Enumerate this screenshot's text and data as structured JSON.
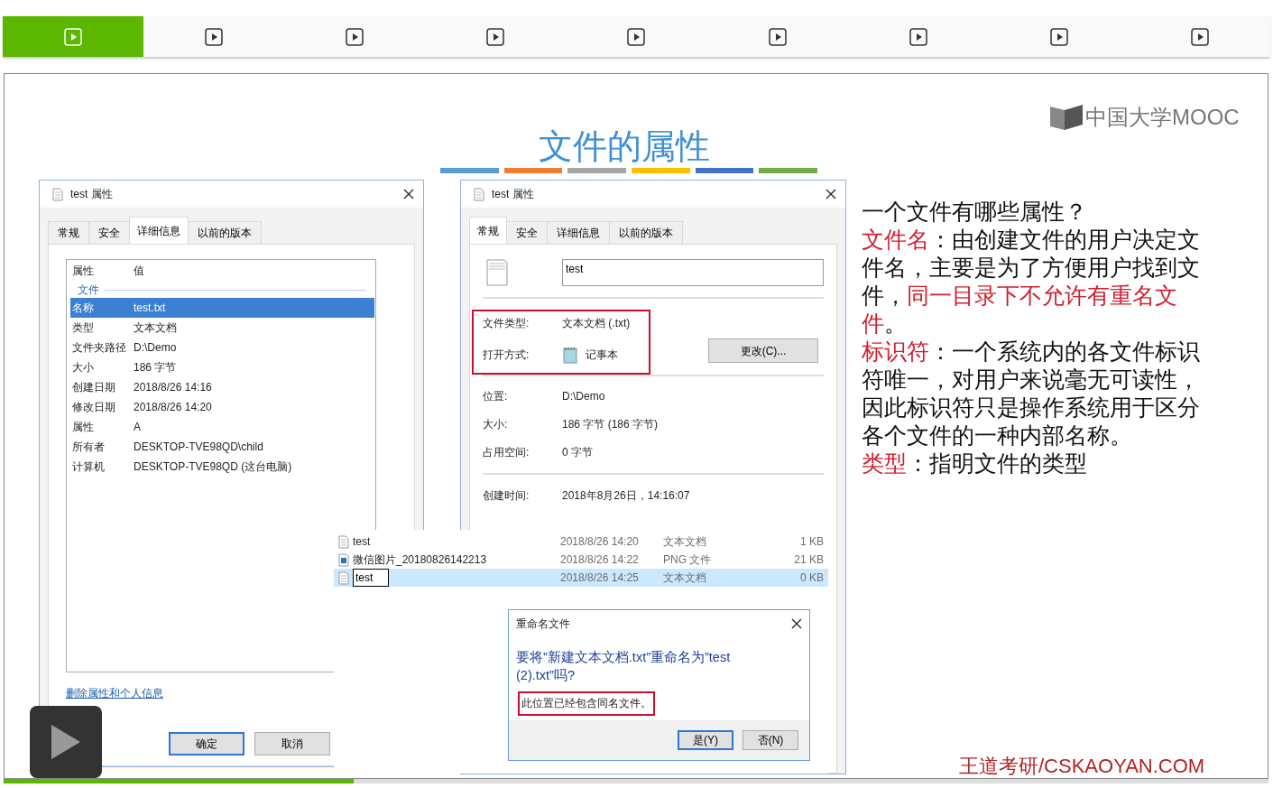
{
  "segments": [
    {
      "selected": true
    },
    {
      "selected": false
    },
    {
      "selected": false
    },
    {
      "selected": false
    },
    {
      "selected": false
    },
    {
      "selected": false
    },
    {
      "selected": false
    },
    {
      "selected": false
    },
    {
      "selected": false
    }
  ],
  "slide": {
    "title": "文件的属性",
    "logo": "中国大学MOOC",
    "details_dialog": {
      "title": "test 属性",
      "tabs": [
        {
          "label": "常规",
          "selected": false
        },
        {
          "label": "安全",
          "selected": false
        },
        {
          "label": "详细信息",
          "selected": true
        },
        {
          "label": "以前的版本",
          "selected": false
        }
      ],
      "columns": [
        "属性",
        "值"
      ],
      "group": "文件",
      "rows": [
        {
          "name": "名称",
          "value": "test.txt",
          "selected": true
        },
        {
          "name": "类型",
          "value": "文本文档",
          "selected": false
        },
        {
          "name": "文件夹路径",
          "value": "D:\\Demo",
          "selected": false
        },
        {
          "name": "大小",
          "value": "186 字节",
          "selected": false
        },
        {
          "name": "创建日期",
          "value": "2018/8/26 14:16",
          "selected": false
        },
        {
          "name": "修改日期",
          "value": "2018/8/26 14:20",
          "selected": false
        },
        {
          "name": "属性",
          "value": "A",
          "selected": false
        },
        {
          "name": "所有者",
          "value": "DESKTOP-TVE98QD\\child",
          "selected": false
        },
        {
          "name": "计算机",
          "value": "DESKTOP-TVE98QD (这台电脑)",
          "selected": false
        }
      ],
      "link": "删除属性和个人信息",
      "buttons": [
        {
          "label": "确定",
          "default": true
        },
        {
          "label": "取消",
          "default": false
        }
      ]
    },
    "general_dialog": {
      "title": "test 属性",
      "tabs": [
        {
          "label": "常规",
          "selected": true
        },
        {
          "label": "安全",
          "selected": false
        },
        {
          "label": "详细信息",
          "selected": false
        },
        {
          "label": "以前的版本",
          "selected": false
        }
      ],
      "name": "test",
      "file_type_label": "文件类型:",
      "file_type": "文本文档 (.txt)",
      "opens_with_label": "打开方式:",
      "opens_with": "记事本",
      "change_button": "更改(C)...",
      "fields": [
        {
          "label": "位置:",
          "value": "D:\\Demo"
        },
        {
          "label": "大小:",
          "value": "186 字节 (186 字节)"
        },
        {
          "label": "占用空间:",
          "value": "0 字节"
        }
      ],
      "created_label": "创建时间:",
      "created": "2018年8月26日，14:16:07"
    },
    "explorer": {
      "rows": [
        {
          "kind": "text",
          "name": "test",
          "date": "2018/8/26 14:20",
          "type": "文本文档",
          "size": "1 KB",
          "selected": false,
          "renaming": false
        },
        {
          "kind": "image",
          "name": "微信图片_20180826142213",
          "date": "2018/8/26 14:22",
          "type": "PNG 文件",
          "size": "21 KB",
          "selected": false,
          "renaming": false
        },
        {
          "kind": "text",
          "name": "test",
          "date": "2018/8/26 14:25",
          "type": "文本文档",
          "size": "0 KB",
          "selected": true,
          "renaming": true
        }
      ]
    },
    "rename_dialog": {
      "title": "重命名文件",
      "question": "要将”新建文本文档.txt”重命名为”test (2).txt”吗?",
      "note": "此位置已经包含同名文件。",
      "buttons": [
        {
          "label": "是(Y)",
          "default": true
        },
        {
          "label": "否(N)",
          "default": false
        }
      ]
    },
    "notes": [
      [
        {
          "text": "一个文件有哪些属性？",
          "highlight": false
        }
      ],
      [
        {
          "text": "文件名",
          "highlight": true
        },
        {
          "text": "：由创建文件的用户决定文件名，主要是为了方便用户找到文件，",
          "highlight": false
        },
        {
          "text": "同一目录下不允许有重名文件",
          "highlight": true
        },
        {
          "text": "。",
          "highlight": false
        }
      ],
      [
        {
          "text": "标识符",
          "highlight": true
        },
        {
          "text": "：一个系统内的各文件标识符唯一，对用户来说毫无可读性，因此标识符只是操作系统用于区分各个文件的一种内部名称。",
          "highlight": false
        }
      ],
      [
        {
          "text": "类型",
          "highlight": true
        },
        {
          "text": "：指明文件的类型",
          "highlight": false
        }
      ]
    ],
    "footer": "王道考研/CSKAOYAN.COM"
  },
  "player": {
    "level": 0.277
  }
}
